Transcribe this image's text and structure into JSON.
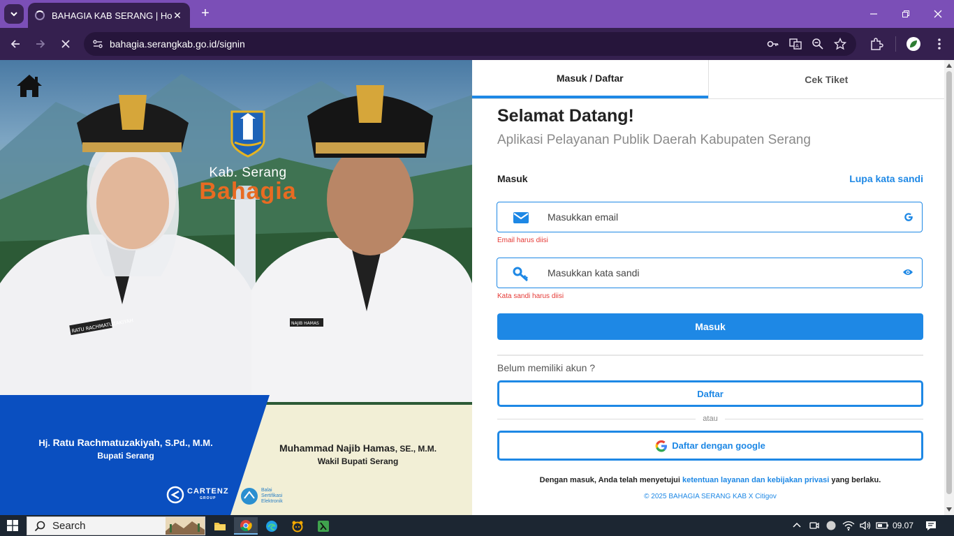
{
  "browser": {
    "tab_title": "BAHAGIA KAB SERANG | Home",
    "url": "bahagia.serangkab.go.id/signin",
    "new_tab_label": "+"
  },
  "hero": {
    "logo_line1": "Kab. Serang",
    "logo_line2": "Bahagia",
    "left_name_prefix": "Hj.",
    "left_name": "Ratu Rachmatuzakiyah",
    "left_name_suffix": ", S.Pd., M.M.",
    "left_role": "Bupati Serang",
    "right_name": "Muhammad Najib Hamas",
    "right_name_suffix": ", SE., M.M.",
    "right_role": "Wakil Bupati Serang",
    "sponsor1": "CARTENZ",
    "sponsor1_sub": "GROUP",
    "sponsor2_lines": [
      "Balai",
      "Sertifikasi",
      "Elektronik"
    ],
    "badge_left": "RATU RACHMATUZAKIYAH",
    "badge_right": "NAJIB HAMAS"
  },
  "form": {
    "tabs": [
      {
        "label": "Masuk / Daftar",
        "active": true
      },
      {
        "label": "Cek Tiket",
        "active": false
      }
    ],
    "welcome": "Selamat Datang!",
    "subtitle": "Aplikasi Pelayanan Publik Daerah Kabupaten Serang",
    "section_label": "Masuk",
    "forgot_link": "Lupa kata sandi",
    "email_placeholder": "Masukkan email",
    "email_error": "Email harus diisi",
    "password_placeholder": "Masukkan kata sandi",
    "password_error": "Kata sandi harus diisi",
    "submit_label": "Masuk",
    "no_account": "Belum memiliki akun ?",
    "register_label": "Daftar",
    "or_label": "atau",
    "google_label": "Daftar dengan google",
    "terms_prefix": "Dengan masuk, Anda telah menyetujui",
    "terms_link": "ketentuan layanan dan kebijakan privasi",
    "terms_suffix": "yang berlaku.",
    "copyright": "© 2025 BAHAGIA SERANG KAB X Citigov"
  },
  "taskbar": {
    "search_label": "Search",
    "time": "09.07"
  },
  "colors": {
    "accent": "#1e88e5",
    "browser_frame": "#7b4fb7",
    "toolbar": "#35204f",
    "error": "#e53935",
    "brand_orange": "#e86b22",
    "hero_blue": "#0a4fc0"
  }
}
